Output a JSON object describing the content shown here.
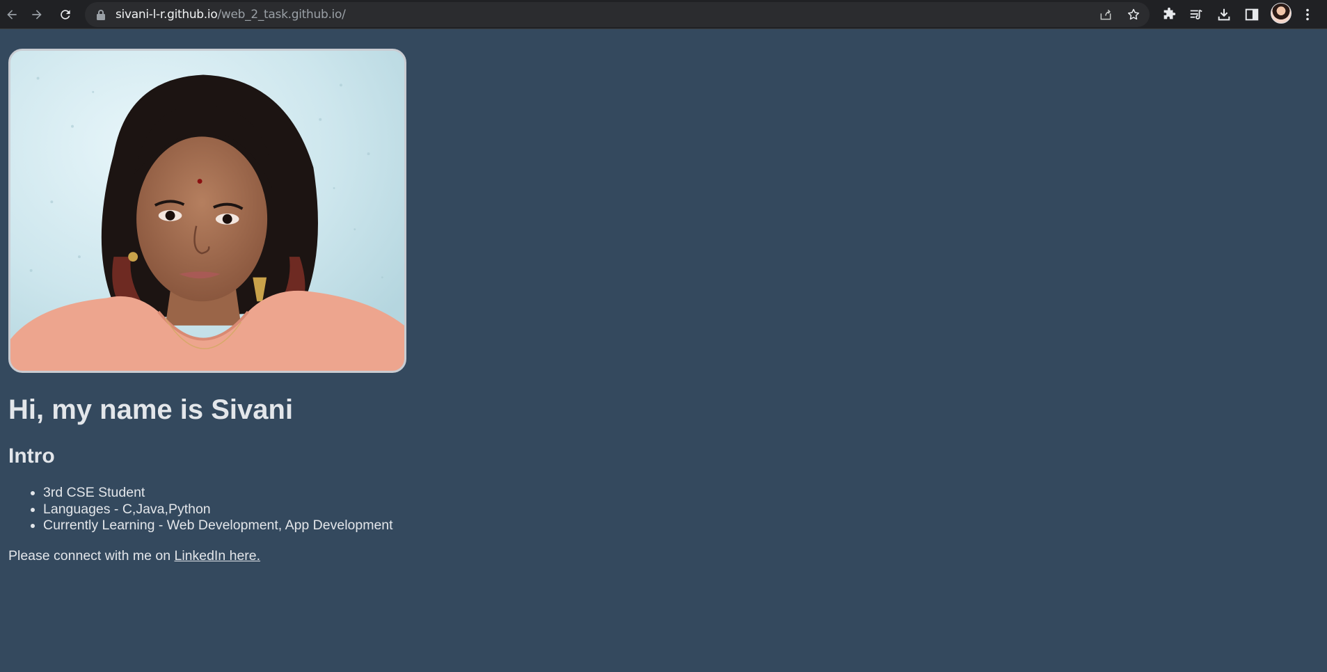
{
  "browser": {
    "url_host": "sivani-l-r.github.io",
    "url_path": "/web_2_task.github.io/",
    "icons": [
      "back-icon",
      "forward-icon",
      "reload-icon",
      "lock-icon",
      "share-icon",
      "bookmark-star-icon",
      "extensions-icon",
      "reading-list-icon",
      "download-icon",
      "side-panel-icon",
      "profile-avatar",
      "menu-kebab-icon"
    ]
  },
  "page": {
    "photo_alt": "profile photo",
    "heading": "Hi, my name is Sivani",
    "subheading": "Intro",
    "intro_items": [
      "3rd CSE Student",
      "Languages - C,Java,Python",
      "Currently Learning - Web Development, App Development"
    ],
    "connect_text": "Please connect with me on ",
    "connect_link": "LinkedIn here."
  },
  "colors": {
    "page_background": "#34495e",
    "text": "#e3e6ea",
    "browser_bar": "#202124"
  }
}
